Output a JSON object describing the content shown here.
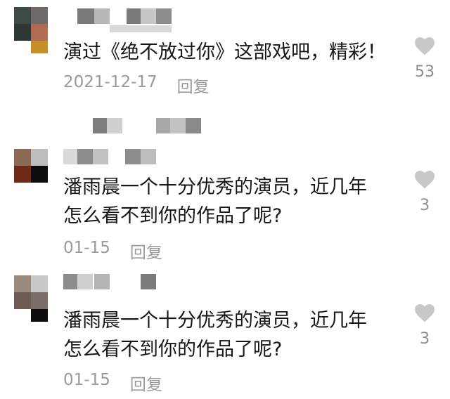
{
  "comments": [
    {
      "text": "演过《绝不放过你》这部戏吧，精彩！",
      "date": "2021-12-17",
      "reply_label": "回复",
      "likes": "53"
    },
    {
      "text": "潘雨晨一个十分优秀的演员，近几年\n怎么看不到你的作品了呢?",
      "date": "01-15",
      "reply_label": "回复",
      "likes": "3"
    },
    {
      "text": "潘雨晨一个十分优秀的演员，近几年\n怎么看不到你的作品了呢?",
      "date": "01-15",
      "reply_label": "回复",
      "likes": "3"
    }
  ],
  "colors": {
    "text": "#161616",
    "meta": "#9a9a9a",
    "heart": "#c8c8c8"
  },
  "icons": {
    "like": "heart-icon"
  }
}
